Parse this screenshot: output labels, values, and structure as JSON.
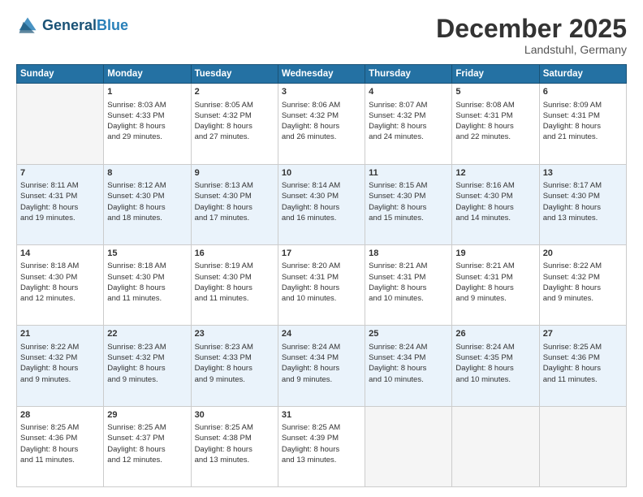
{
  "header": {
    "logo_general": "General",
    "logo_blue": "Blue",
    "month": "December 2025",
    "location": "Landstuhl, Germany"
  },
  "days": [
    "Sunday",
    "Monday",
    "Tuesday",
    "Wednesday",
    "Thursday",
    "Friday",
    "Saturday"
  ],
  "weeks": [
    [
      {
        "day": "",
        "info": ""
      },
      {
        "day": "1",
        "info": "Sunrise: 8:03 AM\nSunset: 4:33 PM\nDaylight: 8 hours\nand 29 minutes."
      },
      {
        "day": "2",
        "info": "Sunrise: 8:05 AM\nSunset: 4:32 PM\nDaylight: 8 hours\nand 27 minutes."
      },
      {
        "day": "3",
        "info": "Sunrise: 8:06 AM\nSunset: 4:32 PM\nDaylight: 8 hours\nand 26 minutes."
      },
      {
        "day": "4",
        "info": "Sunrise: 8:07 AM\nSunset: 4:32 PM\nDaylight: 8 hours\nand 24 minutes."
      },
      {
        "day": "5",
        "info": "Sunrise: 8:08 AM\nSunset: 4:31 PM\nDaylight: 8 hours\nand 22 minutes."
      },
      {
        "day": "6",
        "info": "Sunrise: 8:09 AM\nSunset: 4:31 PM\nDaylight: 8 hours\nand 21 minutes."
      }
    ],
    [
      {
        "day": "7",
        "info": "Sunrise: 8:11 AM\nSunset: 4:31 PM\nDaylight: 8 hours\nand 19 minutes."
      },
      {
        "day": "8",
        "info": "Sunrise: 8:12 AM\nSunset: 4:30 PM\nDaylight: 8 hours\nand 18 minutes."
      },
      {
        "day": "9",
        "info": "Sunrise: 8:13 AM\nSunset: 4:30 PM\nDaylight: 8 hours\nand 17 minutes."
      },
      {
        "day": "10",
        "info": "Sunrise: 8:14 AM\nSunset: 4:30 PM\nDaylight: 8 hours\nand 16 minutes."
      },
      {
        "day": "11",
        "info": "Sunrise: 8:15 AM\nSunset: 4:30 PM\nDaylight: 8 hours\nand 15 minutes."
      },
      {
        "day": "12",
        "info": "Sunrise: 8:16 AM\nSunset: 4:30 PM\nDaylight: 8 hours\nand 14 minutes."
      },
      {
        "day": "13",
        "info": "Sunrise: 8:17 AM\nSunset: 4:30 PM\nDaylight: 8 hours\nand 13 minutes."
      }
    ],
    [
      {
        "day": "14",
        "info": "Sunrise: 8:18 AM\nSunset: 4:30 PM\nDaylight: 8 hours\nand 12 minutes."
      },
      {
        "day": "15",
        "info": "Sunrise: 8:18 AM\nSunset: 4:30 PM\nDaylight: 8 hours\nand 11 minutes."
      },
      {
        "day": "16",
        "info": "Sunrise: 8:19 AM\nSunset: 4:30 PM\nDaylight: 8 hours\nand 11 minutes."
      },
      {
        "day": "17",
        "info": "Sunrise: 8:20 AM\nSunset: 4:31 PM\nDaylight: 8 hours\nand 10 minutes."
      },
      {
        "day": "18",
        "info": "Sunrise: 8:21 AM\nSunset: 4:31 PM\nDaylight: 8 hours\nand 10 minutes."
      },
      {
        "day": "19",
        "info": "Sunrise: 8:21 AM\nSunset: 4:31 PM\nDaylight: 8 hours\nand 9 minutes."
      },
      {
        "day": "20",
        "info": "Sunrise: 8:22 AM\nSunset: 4:32 PM\nDaylight: 8 hours\nand 9 minutes."
      }
    ],
    [
      {
        "day": "21",
        "info": "Sunrise: 8:22 AM\nSunset: 4:32 PM\nDaylight: 8 hours\nand 9 minutes."
      },
      {
        "day": "22",
        "info": "Sunrise: 8:23 AM\nSunset: 4:32 PM\nDaylight: 8 hours\nand 9 minutes."
      },
      {
        "day": "23",
        "info": "Sunrise: 8:23 AM\nSunset: 4:33 PM\nDaylight: 8 hours\nand 9 minutes."
      },
      {
        "day": "24",
        "info": "Sunrise: 8:24 AM\nSunset: 4:34 PM\nDaylight: 8 hours\nand 9 minutes."
      },
      {
        "day": "25",
        "info": "Sunrise: 8:24 AM\nSunset: 4:34 PM\nDaylight: 8 hours\nand 10 minutes."
      },
      {
        "day": "26",
        "info": "Sunrise: 8:24 AM\nSunset: 4:35 PM\nDaylight: 8 hours\nand 10 minutes."
      },
      {
        "day": "27",
        "info": "Sunrise: 8:25 AM\nSunset: 4:36 PM\nDaylight: 8 hours\nand 11 minutes."
      }
    ],
    [
      {
        "day": "28",
        "info": "Sunrise: 8:25 AM\nSunset: 4:36 PM\nDaylight: 8 hours\nand 11 minutes."
      },
      {
        "day": "29",
        "info": "Sunrise: 8:25 AM\nSunset: 4:37 PM\nDaylight: 8 hours\nand 12 minutes."
      },
      {
        "day": "30",
        "info": "Sunrise: 8:25 AM\nSunset: 4:38 PM\nDaylight: 8 hours\nand 13 minutes."
      },
      {
        "day": "31",
        "info": "Sunrise: 8:25 AM\nSunset: 4:39 PM\nDaylight: 8 hours\nand 13 minutes."
      },
      {
        "day": "",
        "info": ""
      },
      {
        "day": "",
        "info": ""
      },
      {
        "day": "",
        "info": ""
      }
    ]
  ]
}
